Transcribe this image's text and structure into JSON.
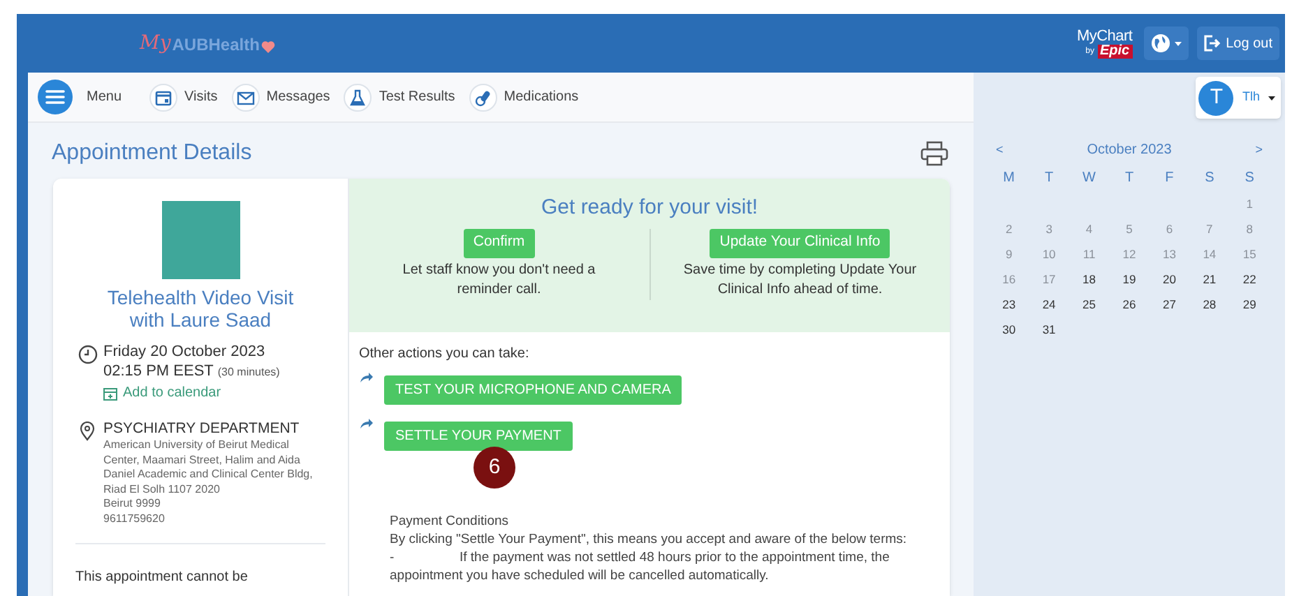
{
  "header": {
    "logo": {
      "script": "My",
      "name": "AUBHealth"
    },
    "mychart": {
      "name": "MyChart",
      "by": "by",
      "brand": "Epic"
    },
    "logout": "Log out"
  },
  "nav": {
    "menu": "Menu",
    "items": [
      {
        "label": "Visits"
      },
      {
        "label": "Messages"
      },
      {
        "label": "Test Results"
      },
      {
        "label": "Medications"
      }
    ],
    "user": {
      "initial": "T",
      "name": "Tlh"
    }
  },
  "page_title": "Appointment Details",
  "appointment": {
    "title": "Telehealth Video Visit with Laure Saad",
    "date": "Friday 20 October 2023",
    "time": "02:15 PM EEST",
    "duration": "(30 minutes)",
    "add_to_calendar": "Add to calendar",
    "department": "PSYCHIATRY DEPARTMENT",
    "address": [
      "American University of Beirut Medical Center, Maamari Street, Halim and Aida Daniel Academic and Clinical Center Bldg, Riad El Solh 1107 2020",
      "Beirut 9999",
      "9611759620"
    ],
    "note": "This appointment cannot be"
  },
  "get_ready": {
    "title": "Get ready for your visit!",
    "actions": [
      {
        "button": "Confirm",
        "text": "Let staff know you don't need a reminder call."
      },
      {
        "button": "Update Your Clinical Info",
        "text": "Save time by completing Update Your Clinical Info ahead of time."
      }
    ]
  },
  "other_actions": {
    "label": "Other actions you can take:",
    "buttons": [
      "TEST YOUR MICROPHONE AND CAMERA",
      "SETTLE YOUR PAYMENT"
    ]
  },
  "annotation": "6",
  "payment_conditions": {
    "title": "Payment Conditions",
    "text": "By clicking \"Settle Your Payment\", this means you accept and aware of the below terms:",
    "bullet": "-",
    "term": "If the payment was not settled 48 hours prior to the appointment time, the appointment you have scheduled will be cancelled automatically."
  },
  "calendar": {
    "prev": "<",
    "month": "October 2023",
    "next": ">",
    "weekdays": [
      "M",
      "T",
      "W",
      "T",
      "F",
      "S",
      "S"
    ],
    "weeks": [
      [
        {
          "kind": "blank"
        },
        {
          "kind": "blank"
        },
        {
          "kind": "blank"
        },
        {
          "kind": "blank"
        },
        {
          "kind": "blank"
        },
        {
          "kind": "blank"
        },
        {
          "kind": "day",
          "label": "1",
          "disabled": true
        }
      ],
      [
        {
          "kind": "day",
          "label": "2",
          "disabled": true
        },
        {
          "kind": "day",
          "label": "3",
          "disabled": true
        },
        {
          "kind": "day",
          "label": "4",
          "disabled": true
        },
        {
          "kind": "day",
          "label": "5",
          "disabled": true
        },
        {
          "kind": "day",
          "label": "6",
          "disabled": true
        },
        {
          "kind": "day",
          "label": "7",
          "disabled": true
        },
        {
          "kind": "day",
          "label": "8",
          "disabled": true
        }
      ],
      [
        {
          "kind": "day",
          "label": "9",
          "disabled": true
        },
        {
          "kind": "day",
          "label": "10",
          "disabled": true
        },
        {
          "kind": "day",
          "label": "11",
          "disabled": true
        },
        {
          "kind": "day",
          "label": "12",
          "disabled": true
        },
        {
          "kind": "day",
          "label": "13",
          "disabled": true
        },
        {
          "kind": "day",
          "label": "14",
          "disabled": true
        },
        {
          "kind": "day",
          "label": "15",
          "disabled": true
        }
      ],
      [
        {
          "kind": "day",
          "label": "16",
          "disabled": true
        },
        {
          "kind": "day",
          "label": "17",
          "disabled": true
        },
        {
          "kind": "day",
          "label": "18",
          "disabled": false
        },
        {
          "kind": "day",
          "label": "19",
          "disabled": false
        },
        {
          "kind": "day",
          "label": "20",
          "disabled": false
        },
        {
          "kind": "day",
          "label": "21",
          "disabled": false
        },
        {
          "kind": "day",
          "label": "22",
          "disabled": false
        }
      ],
      [
        {
          "kind": "day",
          "label": "23",
          "disabled": false
        },
        {
          "kind": "day",
          "label": "24",
          "disabled": false
        },
        {
          "kind": "day",
          "label": "25",
          "disabled": false
        },
        {
          "kind": "day",
          "label": "26",
          "disabled": false
        },
        {
          "kind": "day",
          "label": "27",
          "disabled": false
        },
        {
          "kind": "day",
          "label": "28",
          "disabled": false
        },
        {
          "kind": "day",
          "label": "29",
          "disabled": false
        }
      ],
      [
        {
          "kind": "day",
          "label": "30",
          "disabled": false
        },
        {
          "kind": "day",
          "label": "31",
          "disabled": false
        }
      ]
    ]
  }
}
